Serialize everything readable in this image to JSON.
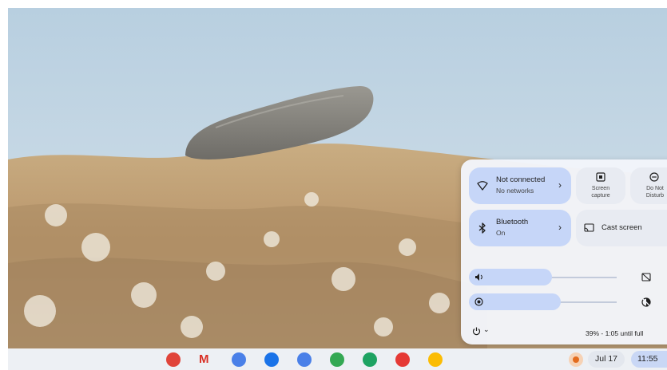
{
  "quick_settings": {
    "network": {
      "title": "Not connected",
      "subtitle": "No networks",
      "icon": "wifi-off-icon"
    },
    "screen_capture": {
      "label": "Screen\ncapture",
      "icon": "screen-capture-icon"
    },
    "do_not_disturb": {
      "label": "Do Not\nDisturb",
      "icon": "do-not-disturb-icon"
    },
    "bluetooth": {
      "title": "Bluetooth",
      "subtitle": "On",
      "icon": "bluetooth-icon"
    },
    "cast": {
      "label": "Cast screen",
      "icon": "cast-icon"
    },
    "volume": {
      "level_percent": 56,
      "icon": "volume-icon"
    },
    "brightness": {
      "level_percent": 62,
      "icon": "brightness-icon"
    },
    "battery_text": "39% - 1:05 until full"
  },
  "shelf": {
    "apps": [
      {
        "name": "chrome-icon",
        "color": "#e0443a"
      },
      {
        "name": "gmail-icon",
        "color": "#d93025"
      },
      {
        "name": "calendar-icon",
        "color": "#4a80e8"
      },
      {
        "name": "files-icon",
        "color": "#1a73e8"
      },
      {
        "name": "messages-icon",
        "color": "#4a80e8"
      },
      {
        "name": "meet-icon",
        "color": "#34a853"
      },
      {
        "name": "play-store-icon",
        "color": "#1ea362"
      },
      {
        "name": "youtube-icon",
        "color": "#e53935"
      },
      {
        "name": "photos-icon",
        "color": "#fbbc04"
      }
    ],
    "date": "Jul 17",
    "time": "11:55"
  }
}
